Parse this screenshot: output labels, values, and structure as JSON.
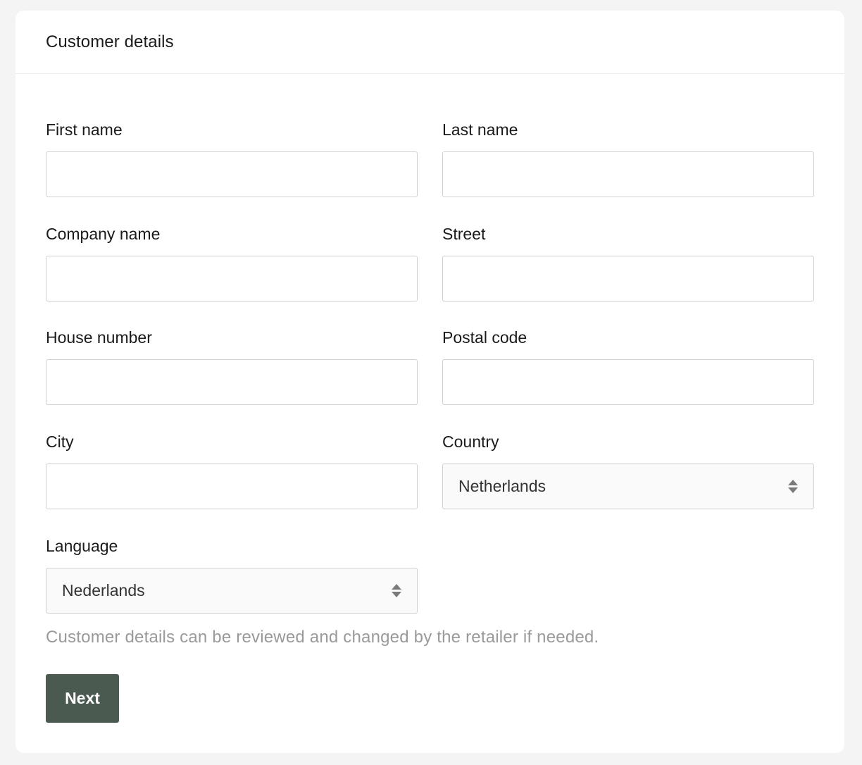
{
  "card": {
    "title": "Customer details"
  },
  "fields": {
    "first_name": {
      "label": "First name",
      "value": ""
    },
    "last_name": {
      "label": "Last name",
      "value": ""
    },
    "company_name": {
      "label": "Company name",
      "value": ""
    },
    "street": {
      "label": "Street",
      "value": ""
    },
    "house_number": {
      "label": "House number",
      "value": ""
    },
    "postal_code": {
      "label": "Postal code",
      "value": ""
    },
    "city": {
      "label": "City",
      "value": ""
    },
    "country": {
      "label": "Country",
      "value": "Netherlands",
      "icon": "sort-icon"
    },
    "language": {
      "label": "Language",
      "value": "Nederlands",
      "icon": "sort-icon"
    }
  },
  "helper_text": "Customer details can be reviewed and changed by the retailer if needed.",
  "actions": {
    "next_label": "Next"
  },
  "colors": {
    "background": "#f4f4f5",
    "card": "#ffffff",
    "primary_button": "#4b5a50",
    "helper_text": "#9a9a9a"
  }
}
